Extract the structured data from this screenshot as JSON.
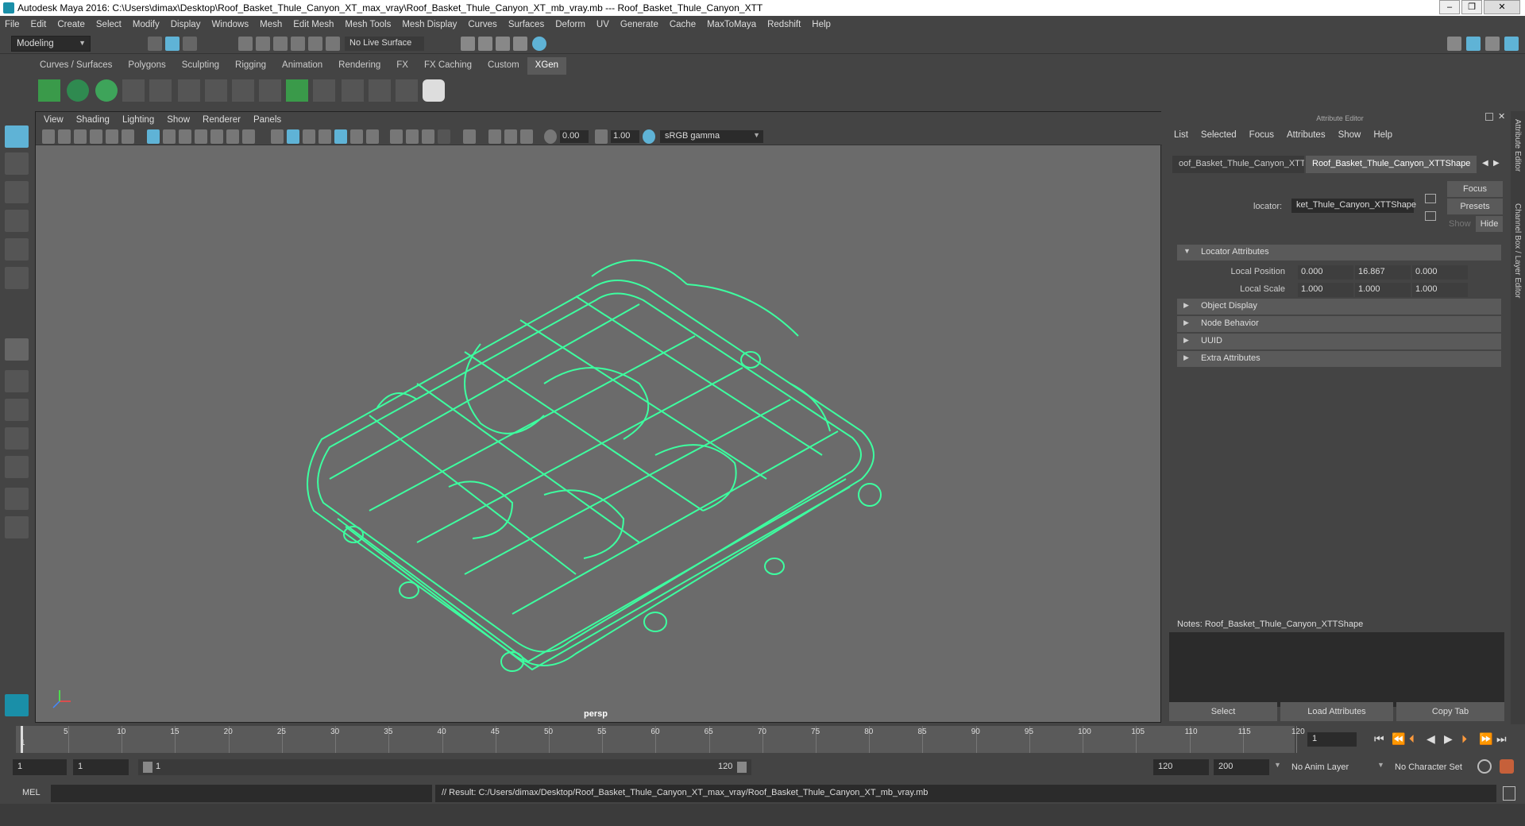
{
  "window": {
    "title": "Autodesk Maya 2016: C:\\Users\\dimax\\Desktop\\Roof_Basket_Thule_Canyon_XT_max_vray\\Roof_Basket_Thule_Canyon_XT_mb_vray.mb   ---   Roof_Basket_Thule_Canyon_XTT",
    "controls": [
      "–",
      "❐",
      "✕"
    ]
  },
  "menubar": [
    "File",
    "Edit",
    "Create",
    "Select",
    "Modify",
    "Display",
    "Windows",
    "Mesh",
    "Edit Mesh",
    "Mesh Tools",
    "Mesh Display",
    "Curves",
    "Surfaces",
    "Deform",
    "UV",
    "Generate",
    "Cache",
    "MaxToMaya",
    "Redshift",
    "Help"
  ],
  "statusline": {
    "mode": "Modeling",
    "live_surface": "No Live Surface"
  },
  "shelf": {
    "tabs": [
      "Curves / Surfaces",
      "Polygons",
      "Sculpting",
      "Rigging",
      "Animation",
      "Rendering",
      "FX",
      "FX Caching",
      "Custom",
      "XGen"
    ],
    "active": "XGen"
  },
  "viewport": {
    "menu": [
      "View",
      "Shading",
      "Lighting",
      "Show",
      "Renderer",
      "Panels"
    ],
    "exposure": "0.00",
    "gamma_value": "1.00",
    "color_space": "sRGB gamma",
    "camera": "persp"
  },
  "attribute_editor": {
    "header": "Attribute Editor",
    "menu": [
      "List",
      "Selected",
      "Focus",
      "Attributes",
      "Show",
      "Help"
    ],
    "tabs": [
      "oof_Basket_Thule_Canyon_XTT",
      "Roof_Basket_Thule_Canyon_XTTShape"
    ],
    "locator_label": "locator:",
    "locator_value": "ket_Thule_Canyon_XTTShape",
    "buttons": {
      "focus": "Focus",
      "presets": "Presets",
      "show": "Show",
      "hide": "Hide"
    },
    "sections": {
      "locator": "Locator Attributes",
      "object_display": "Object Display",
      "node_behavior": "Node Behavior",
      "uuid": "UUID",
      "extra": "Extra Attributes"
    },
    "local_position": {
      "label": "Local Position",
      "x": "0.000",
      "y": "16.867",
      "z": "0.000"
    },
    "local_scale": {
      "label": "Local Scale",
      "x": "1.000",
      "y": "1.000",
      "z": "1.000"
    },
    "notes": "Notes:  Roof_Basket_Thule_Canyon_XTTShape",
    "bottom_buttons": {
      "select": "Select",
      "load": "Load Attributes",
      "copy": "Copy Tab"
    }
  },
  "right_strip": [
    "Attribute Editor",
    "Channel Box / Layer Editor"
  ],
  "timeline": {
    "ticks": [
      "5",
      "10",
      "15",
      "20",
      "25",
      "30",
      "35",
      "40",
      "45",
      "50",
      "55",
      "60",
      "65",
      "70",
      "75",
      "80",
      "85",
      "90",
      "95",
      "100",
      "105",
      "110",
      "115",
      "120"
    ],
    "start_label": "1",
    "current_frame": "1"
  },
  "range": {
    "start": "1",
    "start2": "1",
    "slider_start": "1",
    "slider_end": "120",
    "end": "120",
    "max": "200",
    "anim_layer": "No Anim Layer",
    "character_set": "No Character Set"
  },
  "cmdline": {
    "lang": "MEL",
    "result": "// Result: C:/Users/dimax/Desktop/Roof_Basket_Thule_Canyon_XT_max_vray/Roof_Basket_Thule_Canyon_XT_mb_vray.mb"
  },
  "colors": {
    "wire": "#3dffa0",
    "accent": "#5fb3d6"
  }
}
